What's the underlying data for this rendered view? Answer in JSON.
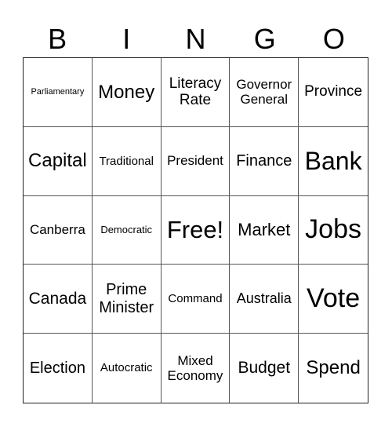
{
  "header": [
    "B",
    "I",
    "N",
    "G",
    "O"
  ],
  "cells": [
    [
      "Parliamentary",
      "Money",
      "Literacy Rate",
      "Governor General",
      "Province"
    ],
    [
      "Capital",
      "Traditional",
      "President",
      "Finance",
      "Bank"
    ],
    [
      "Canberra",
      "Democratic",
      "Free!",
      "Market",
      "Jobs"
    ],
    [
      "Canada",
      "Prime Minister",
      "Command",
      "Australia",
      "Vote"
    ],
    [
      "Election",
      "Autocratic",
      "Mixed Economy",
      "Budget",
      "Spend"
    ]
  ]
}
